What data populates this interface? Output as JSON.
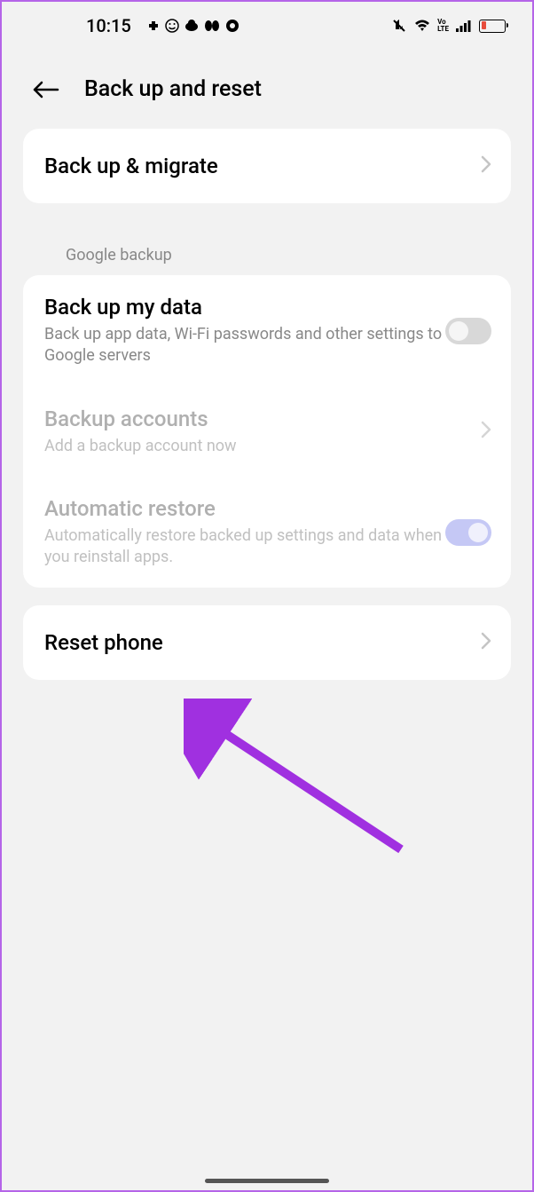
{
  "statusBar": {
    "time": "10:15"
  },
  "header": {
    "title": "Back up and reset"
  },
  "backupMigrate": {
    "title": "Back up & migrate"
  },
  "sectionLabel": "Google backup",
  "backupMyData": {
    "title": "Back up my data",
    "subtitle": "Back up app data, Wi-Fi passwords and other settings to Google servers"
  },
  "backupAccounts": {
    "title": "Backup accounts",
    "subtitle": "Add a backup account now"
  },
  "automaticRestore": {
    "title": "Automatic restore",
    "subtitle": "Automatically restore backed up settings and data when you reinstall apps."
  },
  "resetPhone": {
    "title": "Reset phone"
  }
}
